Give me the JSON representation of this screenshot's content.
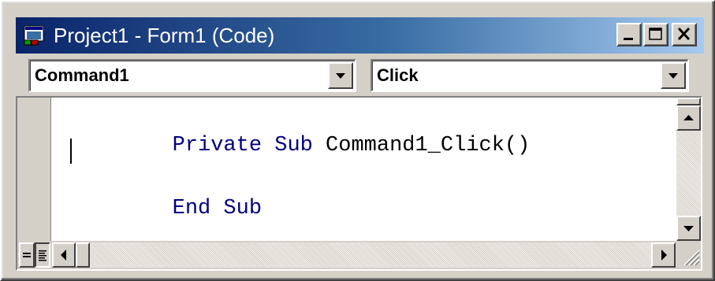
{
  "window": {
    "title": "Project1 - Form1 (Code)"
  },
  "caption_buttons": {
    "minimize": "_",
    "maximize": "□",
    "close": "✕"
  },
  "object_combo": {
    "selected": "Command1"
  },
  "procedure_combo": {
    "selected": "Click"
  },
  "code": {
    "line1_keyword": "Private Sub",
    "line1_rest": " Command1_Click()",
    "line3_keyword": "End Sub"
  },
  "colors": {
    "keyword": "#00007f",
    "titlebar_start": "#0a246a",
    "titlebar_end": "#a6caf0"
  },
  "icons": [
    "form-app-icon",
    "minimize-icon",
    "maximize-icon",
    "close-icon",
    "dropdown-arrow-icon",
    "scroll-up-icon",
    "scroll-down-icon",
    "scroll-left-icon",
    "scroll-right-icon",
    "procedure-view-icon",
    "full-module-view-icon",
    "size-grip-icon"
  ]
}
